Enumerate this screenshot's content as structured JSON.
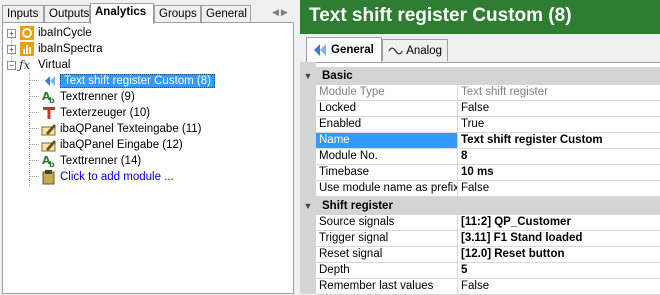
{
  "left_tabs": [
    "Inputs",
    "Outputs",
    "Analytics",
    "Groups",
    "General"
  ],
  "tree": {
    "items": [
      {
        "label": "ibaInCycle",
        "icon": "incycle-icon",
        "expander": "+"
      },
      {
        "label": "ibaInSpectra",
        "icon": "inspectra-icon",
        "expander": "+"
      },
      {
        "label": "Virtual",
        "icon": "function-icon",
        "expander": "−"
      }
    ],
    "children": [
      {
        "label": "Text shift register Custom (8)",
        "icon": "shift-register-icon",
        "selected": true
      },
      {
        "label": "Texttrenner (9)",
        "icon": "text-splitter-icon"
      },
      {
        "label": "Texterzeuger (10)",
        "icon": "text-generator-icon"
      },
      {
        "label": "ibaQPanel Texteingabe (11)",
        "icon": "qpanel-text-icon"
      },
      {
        "label": "ibaQPanel Eingabe (12)",
        "icon": "qpanel-input-icon"
      },
      {
        "label": "Texttrenner (14)",
        "icon": "text-splitter-icon"
      },
      {
        "label": "Click to add module ...",
        "icon": "add-module-icon",
        "link": true
      }
    ]
  },
  "header": {
    "title": "Text shift register Custom (8)",
    "bg_color": "#2e7d32"
  },
  "sub_tabs": [
    {
      "label": "General",
      "icon": "general-tab-icon",
      "active": true
    },
    {
      "label": "Analog",
      "icon": "analog-wave-icon",
      "active": false
    }
  ],
  "properties": {
    "basic": {
      "title": "Basic",
      "rows": [
        {
          "name": "Module Type",
          "value": "Text shift register",
          "greyed": true
        },
        {
          "name": "Locked",
          "value": "False"
        },
        {
          "name": "Enabled",
          "value": "True"
        },
        {
          "name": "Name",
          "value": "Text shift register Custom",
          "bold": true,
          "selected": true
        },
        {
          "name": "Module No.",
          "value": "8",
          "bold": true
        },
        {
          "name": "Timebase",
          "value": "10 ms",
          "bold": true
        },
        {
          "name": "Use module name as prefix",
          "value": "False"
        }
      ]
    },
    "shift": {
      "title": "Shift register",
      "rows": [
        {
          "name": "Source signals",
          "value": "[11:2] QP_Customer",
          "bold": true
        },
        {
          "name": "Trigger signal",
          "value": "[3.11] F1 Stand loaded",
          "bold": true
        },
        {
          "name": "Reset signal",
          "value": "[12.0] Reset button",
          "bold": true
        },
        {
          "name": "Depth",
          "value": "5",
          "bold": true
        },
        {
          "name": "Remember last values",
          "value": "False"
        }
      ]
    }
  }
}
